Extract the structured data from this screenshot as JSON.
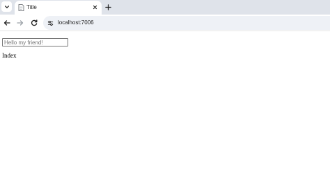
{
  "browser": {
    "tab": {
      "title": "Title",
      "favicon": "document-icon"
    },
    "address_bar": {
      "url": "localhost:7006",
      "site_info_icon": "tune-icon"
    },
    "icons": {
      "tab_search": "chevron-down-icon",
      "tab_close": "close-icon",
      "new_tab": "plus-icon",
      "back": "arrow-left-icon",
      "forward": "arrow-right-icon",
      "reload": "reload-icon"
    },
    "colors": {
      "tabstrip_bg": "#dfe3ea",
      "omnibox_bg": "#eef1f6"
    }
  },
  "page": {
    "input": {
      "placeholder": "Hello my friend!",
      "value": ""
    },
    "text": "Index"
  }
}
